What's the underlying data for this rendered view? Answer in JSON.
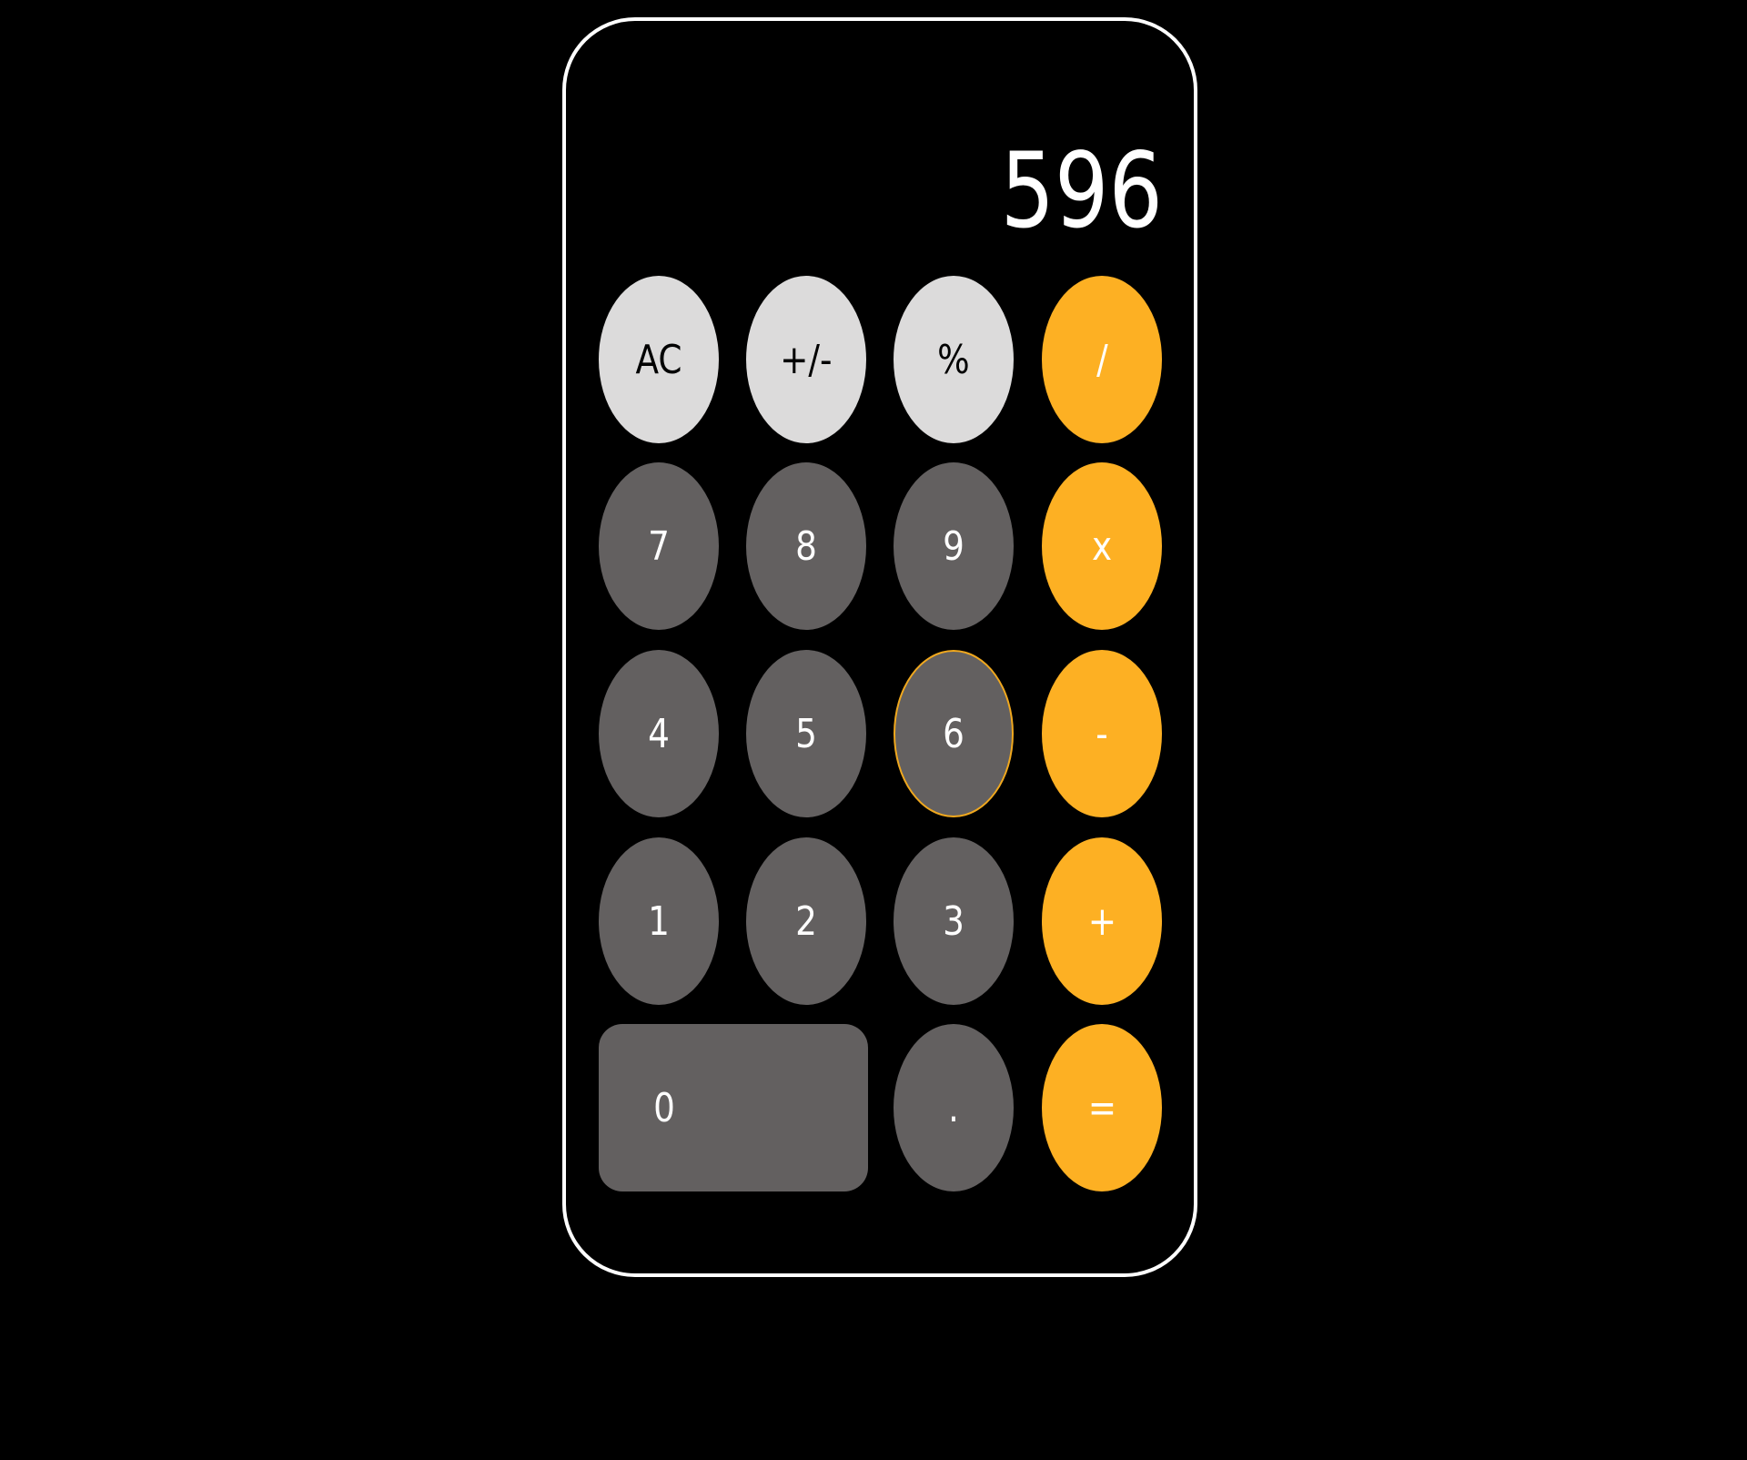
{
  "display": {
    "value": "596"
  },
  "keys": {
    "ac": "AC",
    "sign": "+/-",
    "percent": "%",
    "divide": "/",
    "seven": "7",
    "eight": "8",
    "nine": "9",
    "multiply": "x",
    "four": "4",
    "five": "5",
    "six": "6",
    "subtract": "-",
    "one": "1",
    "two": "2",
    "three": "3",
    "add": "+",
    "zero": "0",
    "decimal": ".",
    "equals": "="
  },
  "colors": {
    "background": "#000000",
    "frame": "#ffffff",
    "function_key": "#dcdbdb",
    "number_key": "#636060",
    "operator_key": "#fdb023",
    "focus_ring": "#f0a81e"
  }
}
